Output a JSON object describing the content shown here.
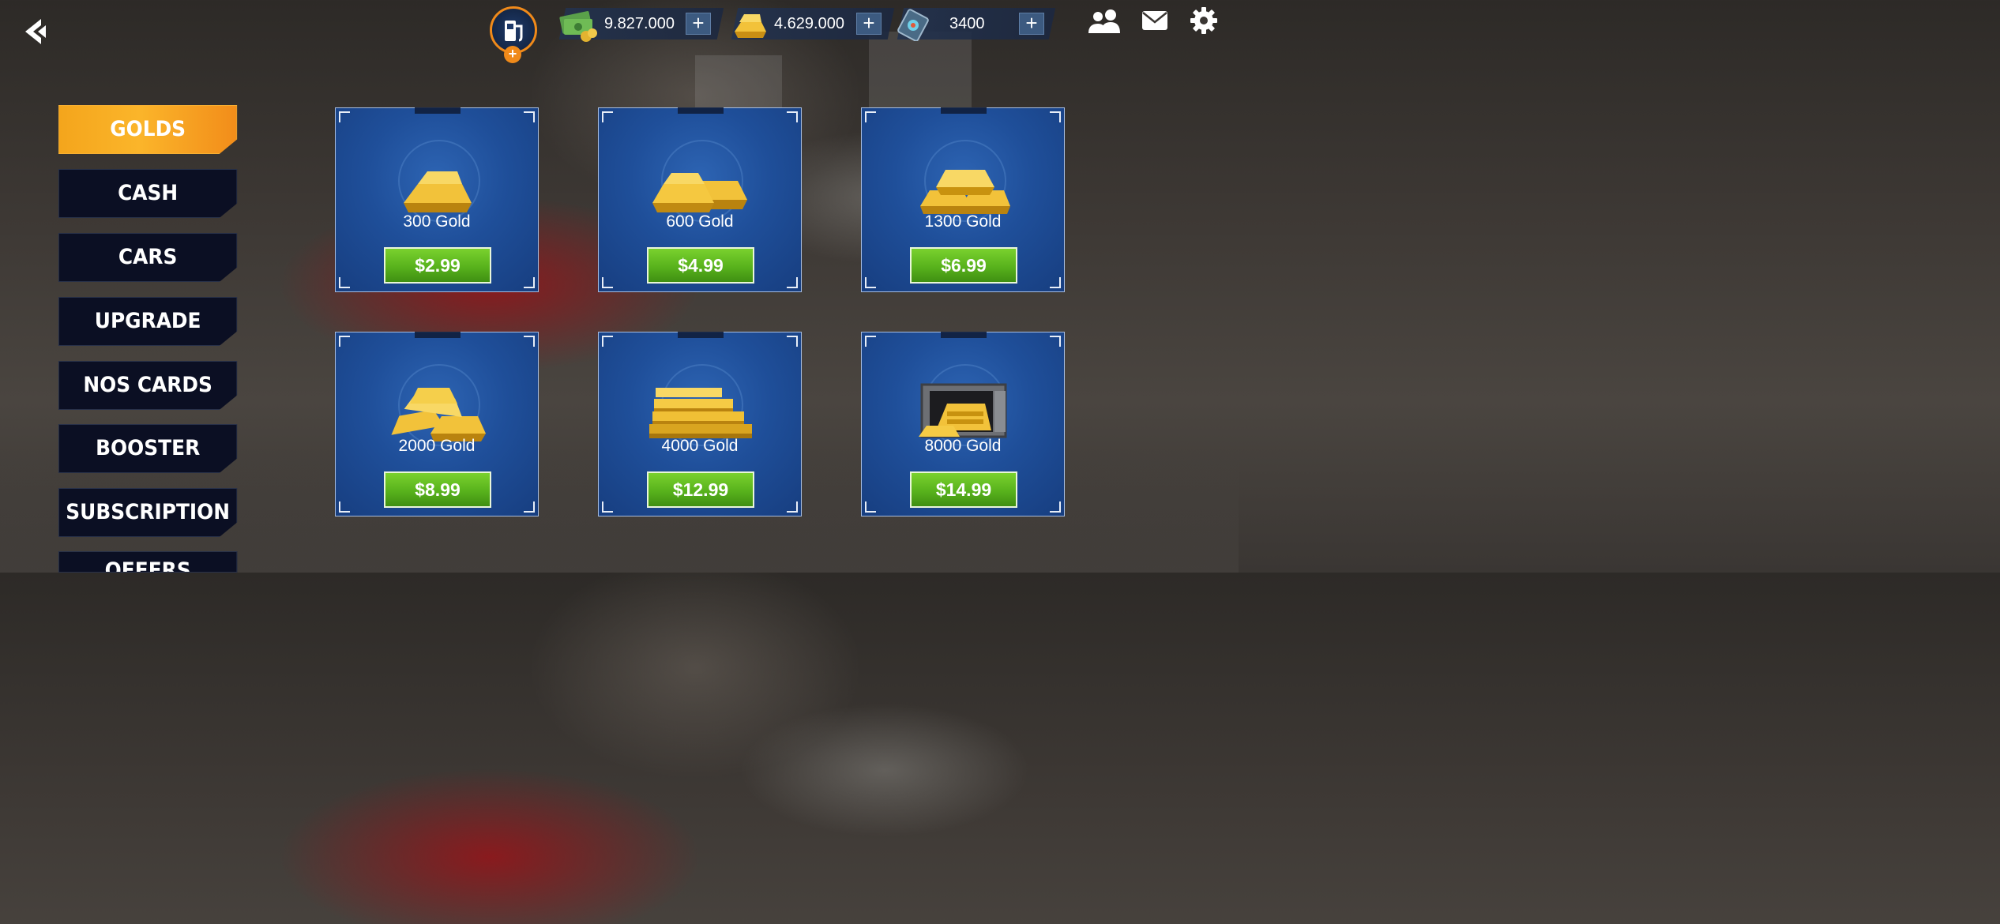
{
  "topbar": {
    "fuel_plus": "+",
    "currencies": [
      {
        "value": "9.827.000",
        "icon": "cash-icon",
        "plus": "+"
      },
      {
        "value": "4.629.000",
        "icon": "gold-icon",
        "plus": "+"
      },
      {
        "value": "3400",
        "icon": "card-chip-icon",
        "plus": "+"
      }
    ]
  },
  "sidebar": {
    "items": [
      {
        "label": "GOLDS",
        "active": true
      },
      {
        "label": "CASH"
      },
      {
        "label": "CARS"
      },
      {
        "label": "UPGRADE"
      },
      {
        "label": "NOS CARDS"
      },
      {
        "label": "BOOSTER"
      },
      {
        "label": "SUBSCRIPTION"
      },
      {
        "label": "OFFERS"
      }
    ]
  },
  "products": [
    {
      "label": "300 Gold",
      "price": "$2.99"
    },
    {
      "label": "600 Gold",
      "price": "$4.99"
    },
    {
      "label": "1300 Gold",
      "price": "$6.99"
    },
    {
      "label": "2000 Gold",
      "price": "$8.99"
    },
    {
      "label": "4000 Gold",
      "price": "$12.99"
    },
    {
      "label": "8000 Gold",
      "price": "$14.99"
    }
  ],
  "colors": {
    "accent_orange": "#f4a51c",
    "button_green": "#58b21c",
    "card_blue": "#1f4f9a",
    "sidebar_dark": "#0b0f23"
  }
}
